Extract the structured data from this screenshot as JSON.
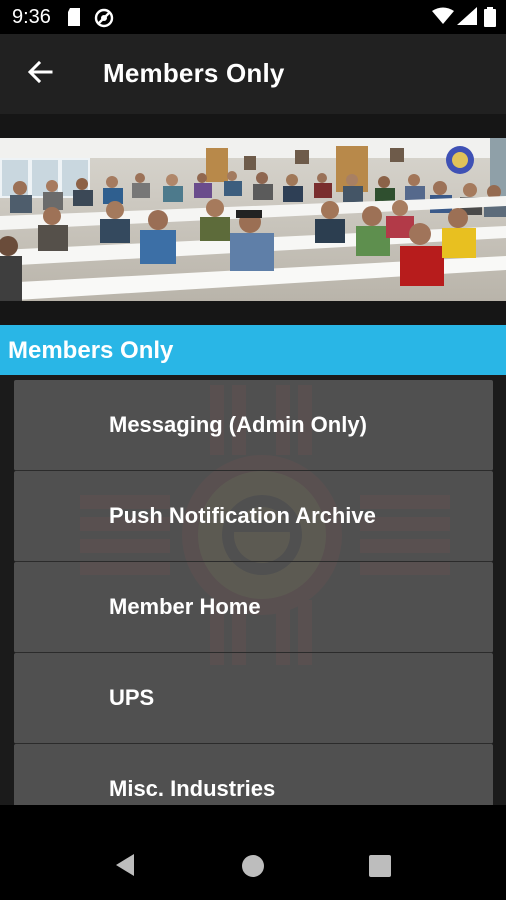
{
  "status_bar": {
    "time": "9:36",
    "icons": [
      "sd-card-icon",
      "dnd-icon",
      "wifi-icon",
      "signal-icon",
      "battery-icon"
    ]
  },
  "app_bar": {
    "back_icon": "arrow-back-icon",
    "title": "Members Only"
  },
  "hero": {
    "image": "members-meeting-photo"
  },
  "section": {
    "title": "Members Only"
  },
  "background_emblem": "teamsters-local-492-logo",
  "menu": {
    "items": [
      {
        "label": "Messaging (Admin Only)"
      },
      {
        "label": "Push Notification Archive"
      },
      {
        "label": "Member Home"
      },
      {
        "label": "UPS"
      },
      {
        "label": "Misc. Industries"
      }
    ]
  },
  "nav_bar": {
    "icons": [
      "nav-back-icon",
      "nav-home-icon",
      "nav-recents-icon"
    ]
  },
  "colors": {
    "accent": "#29b6e6",
    "app_bar": "#212121",
    "menu_item": "#5f5f5f",
    "emblem_red": "#b71c1c"
  }
}
